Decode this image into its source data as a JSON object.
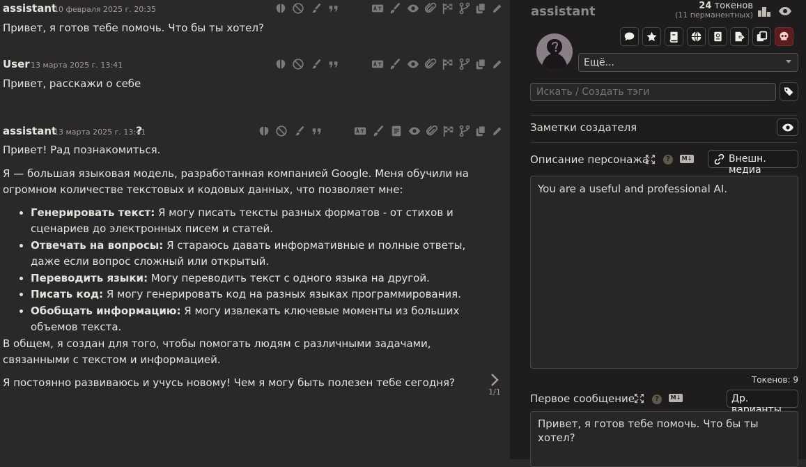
{
  "chat": {
    "messages": [
      {
        "name": "assistant",
        "timestamp": "10 февраля 2025 г. 20:35",
        "text": "Привет, я готов тебе помочь. Что бы ты хотел?"
      },
      {
        "name": "User",
        "timestamp": "13 марта 2025 г. 13:41",
        "text": "Привет, расскажи о себе"
      },
      {
        "name": "assistant",
        "timestamp": "13 марта 2025 г. 13:41",
        "question_mark": "?",
        "intro": "Привет! Рад познакомиться.",
        "para1": "Я — большая языковая модель, разработанная компанией Google. Меня обучили на огромном количестве текстовых и кодовых данных, что позволяет мне:",
        "bullets": [
          {
            "bold": "Генерировать текст:",
            "text": " Я могу писать тексты разных форматов - от стихов и сценариев до электронных писем и статей."
          },
          {
            "bold": "Отвечать на вопросы:",
            "text": " Я стараюсь давать информативные и полные ответы, даже если вопрос сложный или открытый."
          },
          {
            "bold": "Переводить языки:",
            "text": " Могу переводить текст с одного языка на другой."
          },
          {
            "bold": "Писать код:",
            "text": " Я могу генерировать код на разных языках программирования."
          },
          {
            "bold": "Обобщать информацию:",
            "text": " Я могу извлекать ключевые моменты из больших объемов текста."
          }
        ],
        "para2": "В общем, я создан для того, чтобы помогать людям с различными задачами, связанными с текстом и информацией.",
        "para3": "Я постоянно развиваюсь и учусь новому! Чем я могу быть полезен тебе сегодня?",
        "swipe_counter": "1/1"
      }
    ]
  },
  "panel": {
    "character_name": "assistant",
    "tokens_count": "24",
    "tokens_word": " токенов",
    "tokens_permanent": "(11 перманентных)",
    "more_select": "Ещё...",
    "tags_placeholder": "Искать / Создать тэги",
    "creator_notes_label": "Заметки создателя",
    "description_label": "Описание персонажа",
    "external_media_button": "Внешн. медиа",
    "description_value": "You are a useful and professional AI.",
    "description_tokens": "Токенов: 9",
    "first_message_label": "Первое сообщение",
    "alt_greetings_button": "Др. варианты",
    "first_message_value": "Привет, я готов тебе помочь. Что бы ты хотел?",
    "colors": {
      "danger": "#5a1d1d",
      "background": "#1e1c1d",
      "chat_bg": "#2b2829"
    }
  },
  "icons": {
    "message_row_1": [
      "brain-icon",
      "ban-icon",
      "paintbrush-icon",
      "quote-icon",
      "translate-icon",
      "brush-icon",
      "eye-icon",
      "paperclip-icon",
      "flag-icon",
      "branch-icon",
      "copy-icon",
      "pencil-icon"
    ],
    "message_row_3_extra": [
      "document-icon"
    ],
    "toolbar": [
      "chat-bubble-icon",
      "star-icon",
      "book-icon",
      "globe-icon",
      "passport-icon",
      "export-icon",
      "duplicate-icon",
      "skull-icon"
    ]
  }
}
